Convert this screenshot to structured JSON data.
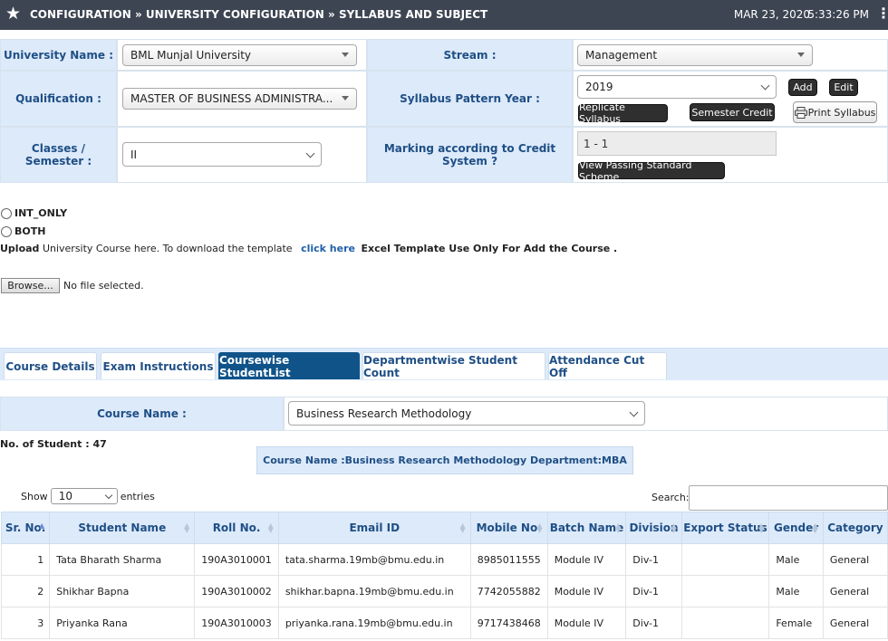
{
  "header": {
    "breadcrumb": "CONFIGURATION » UNIVERSITY CONFIGURATION » SYLLABUS AND SUBJECT",
    "date": "MAR 23, 2020",
    "time": "5:33:26 PM"
  },
  "form": {
    "university_label": "University Name :",
    "university_value": "BML Munjal University",
    "stream_label": "Stream :",
    "stream_value": "Management",
    "qualification_label": "Qualification :",
    "qualification_value": "MASTER OF BUSINESS ADMINISTRA...",
    "pattern_year_label": "Syllabus Pattern Year :",
    "pattern_year_value": "2019",
    "add_label": "Add",
    "edit_label": "Edit",
    "replicate_label": "Replicate Syllabus",
    "semester_credit_label": "Semester Credit",
    "print_label": "Print Syllabus",
    "classes_label": "Classes / Semester :",
    "classes_value": "II",
    "marking_label": "Marking according to Credit System ?",
    "marking_value": "1 - 1",
    "passing_label": "View Passing Standard Scheme"
  },
  "options": {
    "int_only": "INT_ONLY",
    "both": "BOTH"
  },
  "upload": {
    "upload_word": "Upload",
    "text1": "University Course here. To download the template",
    "link": "click here",
    "text2": "Excel Template Use Only For Add the Course .",
    "browse": "Browse...",
    "no_file": "No file selected."
  },
  "tabs": [
    {
      "label": "Course Details",
      "active": false
    },
    {
      "label": "Exam Instructions",
      "active": false
    },
    {
      "label": "Coursewise StudentList",
      "active": true
    },
    {
      "label": "Departmentwise Student Count",
      "active": false
    },
    {
      "label": "Attendance Cut Off",
      "active": false
    }
  ],
  "course": {
    "label": "Course Name :",
    "value": "Business Research Methodology",
    "student_count": "No. of Student : 47",
    "banner": "Course Name :Business Research Methodology  Department:MBA"
  },
  "table_controls": {
    "show": "Show",
    "entries_value": "10",
    "entries": "entries",
    "search": "Search:"
  },
  "table": {
    "columns": [
      "Sr. No.",
      "Student Name",
      "Roll No.",
      "Email ID",
      "Mobile No.",
      "Batch Name",
      "Division",
      "Export Status",
      "Gender",
      "Category"
    ],
    "rows": [
      [
        "1",
        "Tata Bharath Sharma",
        "190A3010001",
        "tata.sharma.19mb@bmu.edu.in",
        "8985011555",
        "Module IV",
        "Div-1",
        "",
        "Male",
        "General"
      ],
      [
        "2",
        "Shikhar Bapna",
        "190A3010002",
        "shikhar.bapna.19mb@bmu.edu.in",
        "7742055882",
        "Module IV",
        "Div-1",
        "",
        "Male",
        "General"
      ],
      [
        "3",
        "Priyanka Rana",
        "190A3010003",
        "priyanka.rana.19mb@bmu.edu.in",
        "9717438468",
        "Module IV",
        "Div-1",
        "",
        "Female",
        "General"
      ]
    ]
  },
  "colors": {
    "topbar": "#3d4553",
    "label_bg": "#ddeafa",
    "label_text": "#1f4f85",
    "active_tab": "#0f5389"
  }
}
